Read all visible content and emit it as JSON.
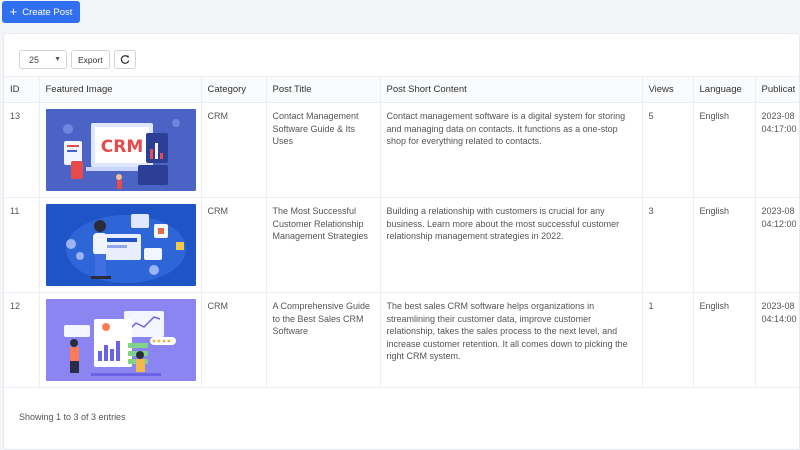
{
  "toolbar": {
    "create_label": "Create Post"
  },
  "table_controls": {
    "page_length": "25",
    "export_label": "Export"
  },
  "columns": [
    "ID",
    "Featured Image",
    "Category",
    "Post Title",
    "Post Short Content",
    "Views",
    "Language",
    "Publicat"
  ],
  "rows": [
    {
      "id": "13",
      "image_icon": "crm-laptop-illustration",
      "category": "CRM",
      "title": "Contact Management Software Guide & Its Uses",
      "content": "Contact management software is a digital system for storing and managing data on contacts. It functions as a one-stop shop for everything related to contacts.",
      "views": "5",
      "language": "English",
      "date": "2023-08",
      "time": "04:17:00"
    },
    {
      "id": "11",
      "image_icon": "relationship-strategy-illustration",
      "category": "CRM",
      "title": "The Most Successful Customer Relationship Management Strategies",
      "content": "Building a relationship with customers is crucial for any business. Learn more about the most successful customer relationship management strategies in 2022.",
      "views": "3",
      "language": "English",
      "date": "2023-08",
      "time": "04:12:00"
    },
    {
      "id": "12",
      "image_icon": "sales-crm-illustration",
      "category": "CRM",
      "title": "A Comprehensive Guide to the Best Sales CRM Software",
      "content": "The best sales CRM software helps organizations in streamlining their customer data, improve customer relationship, takes the sales process to the next level, and increase customer retention. It all comes down to picking the right CRM system.",
      "views": "1",
      "language": "English",
      "date": "2023-08",
      "time": "04:14:00"
    }
  ],
  "footer": {
    "info": "Showing 1 to 3 of 3 entries"
  },
  "crm_logo_text": "CRM",
  "colors": {
    "primary": "#2f6ff0",
    "img1_bg": "#4a63c4",
    "img2_bg": "#1f54c6",
    "img3_bg": "#8a85f0"
  }
}
